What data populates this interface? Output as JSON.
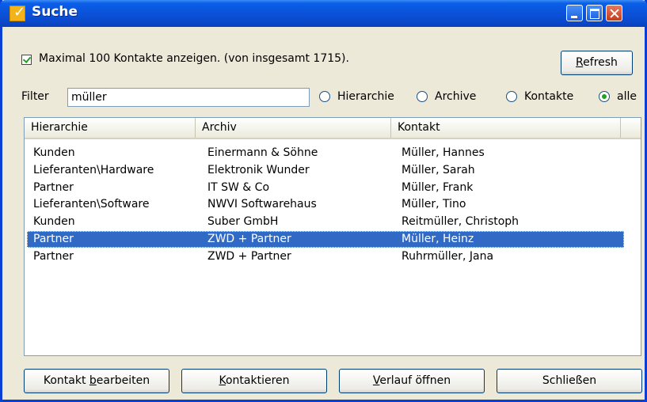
{
  "window": {
    "title": "Suche"
  },
  "options": {
    "max_contacts_label": "Maximal 100 Kontakte anzeigen. (von insgesamt 1715).",
    "refresh_label_pre": "",
    "refresh_label_u": "R",
    "refresh_label_post": "efresh"
  },
  "filter": {
    "label": "Filter",
    "value": "müller",
    "scope_options": [
      "Hierarchie",
      "Archive",
      "Kontakte",
      "alle"
    ],
    "selected_scope": "alle"
  },
  "table": {
    "columns": [
      "Hierarchie",
      "Archiv",
      "Kontakt"
    ],
    "rows": [
      [
        "Kunden",
        "Einermann & Söhne",
        "Müller, Hannes"
      ],
      [
        "Lieferanten\\Hardware",
        "Elektronik Wunder",
        "Müller, Sarah"
      ],
      [
        "Partner",
        "IT SW & Co",
        "Müller, Frank"
      ],
      [
        "Lieferanten\\Software",
        "NWVI Softwarehaus",
        "Müller, Tino"
      ],
      [
        "Kunden",
        "Suber GmbH",
        "Reitmüller, Christoph"
      ],
      [
        "Partner",
        "ZWD + Partner",
        "Müller, Heinz"
      ],
      [
        "Partner",
        "ZWD + Partner",
        "Ruhrmüller, Jana"
      ]
    ],
    "selected_row_index": 5
  },
  "buttons": {
    "edit": {
      "pre": "Kontakt ",
      "u": "b",
      "post": "earbeiten"
    },
    "contact": {
      "pre": "",
      "u": "K",
      "post": "ontaktieren"
    },
    "history": {
      "pre": "",
      "u": "V",
      "post": "erlauf öffnen"
    },
    "close": {
      "pre": "Schließen",
      "u": "",
      "post": ""
    }
  },
  "colors": {
    "titlebar": "#0b52d9",
    "selection": "#316ac5",
    "window_bg": "#ece9d8"
  },
  "icons": [
    "app-icon",
    "minimize-icon",
    "maximize-icon",
    "close-icon"
  ]
}
